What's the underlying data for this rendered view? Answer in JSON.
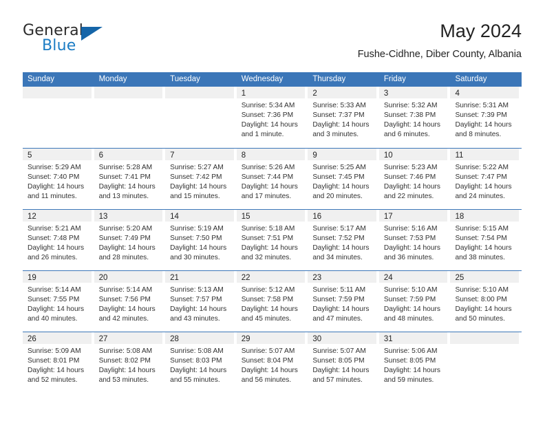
{
  "brand": {
    "word1": "General",
    "word2": "Blue",
    "flag_icon": "triangle-flag-icon",
    "accent_color": "#1b7cc4"
  },
  "header": {
    "title": "May 2024",
    "subtitle": "Fushe-Cidhne, Diber County, Albania"
  },
  "theme": {
    "header_blue": "#3b76b8",
    "date_band_gray": "#f0f0f0",
    "text_dark": "#222222"
  },
  "weekdays": [
    "Sunday",
    "Monday",
    "Tuesday",
    "Wednesday",
    "Thursday",
    "Friday",
    "Saturday"
  ],
  "weeks": [
    [
      {
        "day": "",
        "empty": true
      },
      {
        "day": "",
        "empty": true
      },
      {
        "day": "",
        "empty": true
      },
      {
        "day": "1",
        "sunrise": "Sunrise: 5:34 AM",
        "sunset": "Sunset: 7:36 PM",
        "daylight1": "Daylight: 14 hours",
        "daylight2": "and 1 minute."
      },
      {
        "day": "2",
        "sunrise": "Sunrise: 5:33 AM",
        "sunset": "Sunset: 7:37 PM",
        "daylight1": "Daylight: 14 hours",
        "daylight2": "and 3 minutes."
      },
      {
        "day": "3",
        "sunrise": "Sunrise: 5:32 AM",
        "sunset": "Sunset: 7:38 PM",
        "daylight1": "Daylight: 14 hours",
        "daylight2": "and 6 minutes."
      },
      {
        "day": "4",
        "sunrise": "Sunrise: 5:31 AM",
        "sunset": "Sunset: 7:39 PM",
        "daylight1": "Daylight: 14 hours",
        "daylight2": "and 8 minutes."
      }
    ],
    [
      {
        "day": "5",
        "sunrise": "Sunrise: 5:29 AM",
        "sunset": "Sunset: 7:40 PM",
        "daylight1": "Daylight: 14 hours",
        "daylight2": "and 11 minutes."
      },
      {
        "day": "6",
        "sunrise": "Sunrise: 5:28 AM",
        "sunset": "Sunset: 7:41 PM",
        "daylight1": "Daylight: 14 hours",
        "daylight2": "and 13 minutes."
      },
      {
        "day": "7",
        "sunrise": "Sunrise: 5:27 AM",
        "sunset": "Sunset: 7:42 PM",
        "daylight1": "Daylight: 14 hours",
        "daylight2": "and 15 minutes."
      },
      {
        "day": "8",
        "sunrise": "Sunrise: 5:26 AM",
        "sunset": "Sunset: 7:44 PM",
        "daylight1": "Daylight: 14 hours",
        "daylight2": "and 17 minutes."
      },
      {
        "day": "9",
        "sunrise": "Sunrise: 5:25 AM",
        "sunset": "Sunset: 7:45 PM",
        "daylight1": "Daylight: 14 hours",
        "daylight2": "and 20 minutes."
      },
      {
        "day": "10",
        "sunrise": "Sunrise: 5:23 AM",
        "sunset": "Sunset: 7:46 PM",
        "daylight1": "Daylight: 14 hours",
        "daylight2": "and 22 minutes."
      },
      {
        "day": "11",
        "sunrise": "Sunrise: 5:22 AM",
        "sunset": "Sunset: 7:47 PM",
        "daylight1": "Daylight: 14 hours",
        "daylight2": "and 24 minutes."
      }
    ],
    [
      {
        "day": "12",
        "sunrise": "Sunrise: 5:21 AM",
        "sunset": "Sunset: 7:48 PM",
        "daylight1": "Daylight: 14 hours",
        "daylight2": "and 26 minutes."
      },
      {
        "day": "13",
        "sunrise": "Sunrise: 5:20 AM",
        "sunset": "Sunset: 7:49 PM",
        "daylight1": "Daylight: 14 hours",
        "daylight2": "and 28 minutes."
      },
      {
        "day": "14",
        "sunrise": "Sunrise: 5:19 AM",
        "sunset": "Sunset: 7:50 PM",
        "daylight1": "Daylight: 14 hours",
        "daylight2": "and 30 minutes."
      },
      {
        "day": "15",
        "sunrise": "Sunrise: 5:18 AM",
        "sunset": "Sunset: 7:51 PM",
        "daylight1": "Daylight: 14 hours",
        "daylight2": "and 32 minutes."
      },
      {
        "day": "16",
        "sunrise": "Sunrise: 5:17 AM",
        "sunset": "Sunset: 7:52 PM",
        "daylight1": "Daylight: 14 hours",
        "daylight2": "and 34 minutes."
      },
      {
        "day": "17",
        "sunrise": "Sunrise: 5:16 AM",
        "sunset": "Sunset: 7:53 PM",
        "daylight1": "Daylight: 14 hours",
        "daylight2": "and 36 minutes."
      },
      {
        "day": "18",
        "sunrise": "Sunrise: 5:15 AM",
        "sunset": "Sunset: 7:54 PM",
        "daylight1": "Daylight: 14 hours",
        "daylight2": "and 38 minutes."
      }
    ],
    [
      {
        "day": "19",
        "sunrise": "Sunrise: 5:14 AM",
        "sunset": "Sunset: 7:55 PM",
        "daylight1": "Daylight: 14 hours",
        "daylight2": "and 40 minutes."
      },
      {
        "day": "20",
        "sunrise": "Sunrise: 5:14 AM",
        "sunset": "Sunset: 7:56 PM",
        "daylight1": "Daylight: 14 hours",
        "daylight2": "and 42 minutes."
      },
      {
        "day": "21",
        "sunrise": "Sunrise: 5:13 AM",
        "sunset": "Sunset: 7:57 PM",
        "daylight1": "Daylight: 14 hours",
        "daylight2": "and 43 minutes."
      },
      {
        "day": "22",
        "sunrise": "Sunrise: 5:12 AM",
        "sunset": "Sunset: 7:58 PM",
        "daylight1": "Daylight: 14 hours",
        "daylight2": "and 45 minutes."
      },
      {
        "day": "23",
        "sunrise": "Sunrise: 5:11 AM",
        "sunset": "Sunset: 7:59 PM",
        "daylight1": "Daylight: 14 hours",
        "daylight2": "and 47 minutes."
      },
      {
        "day": "24",
        "sunrise": "Sunrise: 5:10 AM",
        "sunset": "Sunset: 7:59 PM",
        "daylight1": "Daylight: 14 hours",
        "daylight2": "and 48 minutes."
      },
      {
        "day": "25",
        "sunrise": "Sunrise: 5:10 AM",
        "sunset": "Sunset: 8:00 PM",
        "daylight1": "Daylight: 14 hours",
        "daylight2": "and 50 minutes."
      }
    ],
    [
      {
        "day": "26",
        "sunrise": "Sunrise: 5:09 AM",
        "sunset": "Sunset: 8:01 PM",
        "daylight1": "Daylight: 14 hours",
        "daylight2": "and 52 minutes."
      },
      {
        "day": "27",
        "sunrise": "Sunrise: 5:08 AM",
        "sunset": "Sunset: 8:02 PM",
        "daylight1": "Daylight: 14 hours",
        "daylight2": "and 53 minutes."
      },
      {
        "day": "28",
        "sunrise": "Sunrise: 5:08 AM",
        "sunset": "Sunset: 8:03 PM",
        "daylight1": "Daylight: 14 hours",
        "daylight2": "and 55 minutes."
      },
      {
        "day": "29",
        "sunrise": "Sunrise: 5:07 AM",
        "sunset": "Sunset: 8:04 PM",
        "daylight1": "Daylight: 14 hours",
        "daylight2": "and 56 minutes."
      },
      {
        "day": "30",
        "sunrise": "Sunrise: 5:07 AM",
        "sunset": "Sunset: 8:05 PM",
        "daylight1": "Daylight: 14 hours",
        "daylight2": "and 57 minutes."
      },
      {
        "day": "31",
        "sunrise": "Sunrise: 5:06 AM",
        "sunset": "Sunset: 8:05 PM",
        "daylight1": "Daylight: 14 hours",
        "daylight2": "and 59 minutes."
      },
      {
        "day": "",
        "empty": true
      }
    ]
  ]
}
